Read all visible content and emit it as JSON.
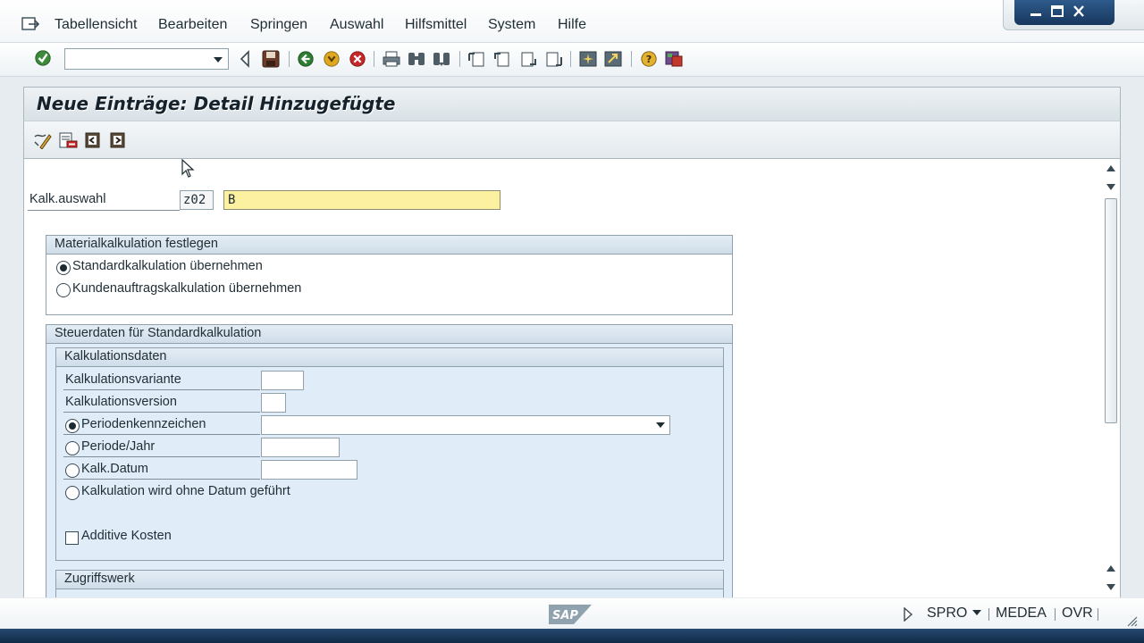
{
  "menu": {
    "items": [
      {
        "id": "tabellensicht",
        "label": "Tabellensicht"
      },
      {
        "id": "bearbeiten",
        "label": "Bearbeiten"
      },
      {
        "id": "springen",
        "label": "Springen"
      },
      {
        "id": "auswahl",
        "label": "Auswahl"
      },
      {
        "id": "hilfsmittel",
        "label": "Hilfsmittel"
      },
      {
        "id": "system",
        "label": "System"
      },
      {
        "id": "hilfe",
        "label": "Hilfe"
      }
    ]
  },
  "toolbar": {
    "command_field_value": "",
    "icons": [
      "enter-checkmark-icon",
      "back-triangle-icon",
      "save-icon",
      "back-green-icon",
      "exit-yellow-icon",
      "cancel-red-icon",
      "print-icon",
      "find-icon",
      "find-next-icon",
      "first-page-icon",
      "previous-page-icon",
      "next-page-icon",
      "last-page-icon",
      "new-session-icon",
      "shortcut-icon",
      "help-icon",
      "customize-layout-icon"
    ]
  },
  "page": {
    "title": "Neue Einträge: Detail Hinzugefügte"
  },
  "app_toolbar": {
    "icons": [
      "display-change-icon",
      "delete-entry-icon",
      "previous-entry-icon",
      "next-entry-icon"
    ]
  },
  "form": {
    "kalk_auswahl": {
      "label": "Kalk.auswahl",
      "code": "z02",
      "value": "B"
    },
    "materialkalkulation": {
      "title": "Materialkalkulation festlegen",
      "options": [
        {
          "label": "Standardkalkulation übernehmen",
          "selected": true
        },
        {
          "label": "Kundenauftragskalkulation übernehmen",
          "selected": false
        }
      ]
    },
    "steuerdaten": {
      "title": "Steuerdaten für Standardkalkulation",
      "kalkulationsdaten": {
        "title": "Kalkulationsdaten",
        "kalkulationsvariante": {
          "label": "Kalkulationsvariante",
          "value": ""
        },
        "kalkulationsversion": {
          "label": "Kalkulationsversion",
          "value": ""
        },
        "periodenkennzeichen": {
          "label": "Periodenkennzeichen",
          "value": "",
          "selected": true
        },
        "periode_jahr": {
          "label": "Periode/Jahr",
          "value": "",
          "selected": false
        },
        "kalk_datum": {
          "label": "Kalk.Datum",
          "value": "",
          "selected": false
        },
        "ohne_datum": {
          "label": "Kalkulation wird ohne Datum geführt",
          "selected": false
        },
        "additive_kosten": {
          "label": "Additive Kosten",
          "checked": false
        }
      },
      "zugriffswerk": {
        "title": "Zugriffswerk"
      }
    }
  },
  "status": {
    "transaction": "SPRO",
    "system": "MEDEA",
    "mode": "OVR",
    "logo": "SAP"
  },
  "colors": {
    "required_field": "#fbf1a0",
    "group_background": "#e0edf8",
    "frame_blue": "#17375d"
  }
}
